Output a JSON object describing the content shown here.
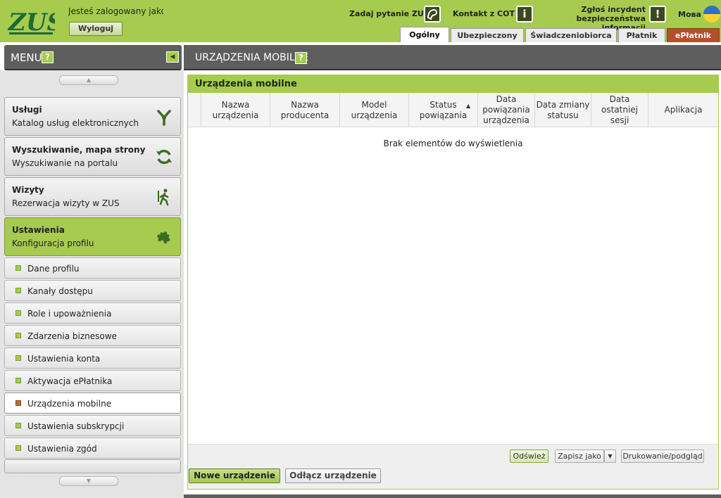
{
  "header": {
    "logo_text": "ZUS",
    "logged_in_text": "Jesteś zalogowany jako",
    "logout_label": "Wyloguj",
    "ask_label": "Zadaj pytanie ZUS",
    "contact_label": "Kontakt z COT",
    "incident_label_line1": "Zgłoś incydent",
    "incident_label_line2": "bezpieczeństwa informacji",
    "lang_label": "Мова",
    "colors": {
      "accent": "#a6cb4f",
      "dark": "#5e5e5e",
      "eplatnik": "#b64e2a"
    }
  },
  "tabs": [
    {
      "label": "Ogólny",
      "active": true
    },
    {
      "label": "Ubezpieczony",
      "active": false
    },
    {
      "label": "Świadczeniobiorca",
      "active": false
    },
    {
      "label": "Płatnik",
      "active": false
    },
    {
      "label": "ePłatnik",
      "active": false
    }
  ],
  "menu": {
    "title": "MENU",
    "help_icon": "question-icon",
    "collapse_icon": "collapse-left-icon",
    "sections": [
      {
        "title": "Usługi",
        "subtitle": "Katalog usług elektronicznych",
        "icon": "services-icon",
        "active": false
      },
      {
        "title": "Wyszukiwanie, mapa strony",
        "subtitle": "Wyszukiwanie na portalu",
        "icon": "refresh-icon",
        "active": false
      },
      {
        "title": "Wizyty",
        "subtitle": "Rezerwacja wizyty w ZUS",
        "icon": "walking-person-icon",
        "active": false
      },
      {
        "title": "Ustawienia",
        "subtitle": "Konfiguracja profilu",
        "icon": "puzzle-icon",
        "active": true
      }
    ],
    "subitems": [
      {
        "label": "Dane profilu",
        "active": false
      },
      {
        "label": "Kanały dostępu",
        "active": false
      },
      {
        "label": "Role i upoważnienia",
        "active": false
      },
      {
        "label": "Zdarzenia biznesowe",
        "active": false
      },
      {
        "label": "Ustawienia konta",
        "active": false
      },
      {
        "label": "Aktywacja ePłatnika",
        "active": false
      },
      {
        "label": "Urządzenia mobilne",
        "active": true
      },
      {
        "label": "Ustawienia subskrypcji",
        "active": false
      },
      {
        "label": "Ustawienia zgód",
        "active": false
      }
    ]
  },
  "content": {
    "title": "URZĄDZENIA MOBILNE",
    "panel_title": "Urządzenia mobilne",
    "columns": [
      {
        "label": "Nazwa urządzenia"
      },
      {
        "label": "Nazwa producenta"
      },
      {
        "label": "Model urządzenia"
      },
      {
        "label": "Status powiązania",
        "sorted": "asc"
      },
      {
        "label": "Data powiązania urządzenia"
      },
      {
        "label": "Data zmiany statusu"
      },
      {
        "label": "Data ostatniej sesji"
      },
      {
        "label": "Aplikacja"
      }
    ],
    "empty_message": "Brak elementów do wyświetlenia",
    "footer": {
      "refresh_label": "Odśwież",
      "save_as_label": "Zapisz jako",
      "print_label": "Drukowanie/podgląd"
    },
    "actions": {
      "new_device_label": "Nowe urządzenie",
      "detach_device_label": "Odłącz urządzenie"
    }
  }
}
